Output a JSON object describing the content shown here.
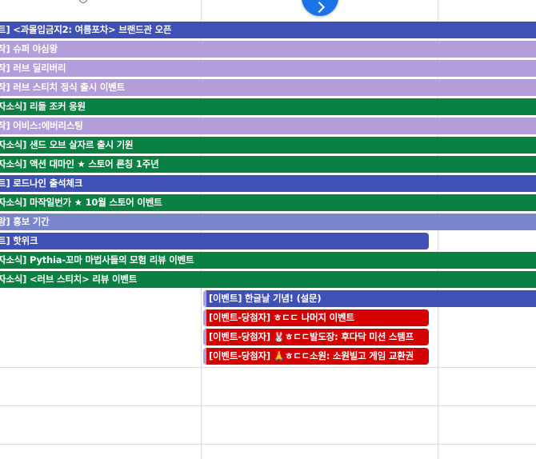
{
  "colors": {
    "blue": "#3f51b5",
    "lavender": "#b39ddb",
    "green": "#0b8043",
    "periwinkle": "#7986cb",
    "red": "#d50000",
    "fab": "#1a73e8"
  },
  "next_button_icon": "chevron-right-icon",
  "multi_day_events": [
    {
      "title": "트] <과몰입금지2: 여름포차> 브랜드관 오픈",
      "color": "blue"
    },
    {
      "title": "작] 슈퍼 야심왕",
      "color": "lavender"
    },
    {
      "title": "작] 러브 딜리버리",
      "color": "lavender"
    },
    {
      "title": "작] 러브 스티치 정식 출시 이벤트",
      "color": "lavender"
    },
    {
      "title": "자소식] 리들 조커 응원",
      "color": "green"
    },
    {
      "title": "작] 어비스:에버리스팅",
      "color": "lavender"
    },
    {
      "title": "자소식] 샌드 오브 살자르 출시 기원",
      "color": "green"
    },
    {
      "title": "자소식] 액션 대마인 ★ 스토어 론칭 1주년",
      "color": "green"
    },
    {
      "title": "트] 로드나인 출석체크",
      "color": "blue"
    },
    {
      "title": "자소식] 마작일번가 ★ 10월 스토어 이벤트",
      "color": "green"
    },
    {
      "title": "랑] 홍보 기간",
      "color": "periwinkle"
    },
    {
      "title": "트] 핫위크",
      "color": "blue"
    },
    {
      "title": "자소식] Pythia-꼬마 마법사들의 모험 리뷰 이벤트",
      "color": "green"
    },
    {
      "title": "자소식] <러브 스티치> 리뷰 이벤트",
      "color": "green"
    }
  ],
  "day_events": [
    {
      "title": "[이벤트] 한글날 기념! (설문)",
      "color": "blue"
    },
    {
      "title": "[이벤트-당첨자] ㅎㄷㄷ 나머지 이벤트",
      "color": "red"
    },
    {
      "title": "[이벤트-당첨자] 🐰ㅎㄷㄷ발도장: 후다닥 미션 스템프",
      "color": "red"
    },
    {
      "title": "[이벤트-당첨자] 🙏ㅎㄷㄷ소원: 소원빌고 게임 교환권",
      "color": "red"
    }
  ]
}
